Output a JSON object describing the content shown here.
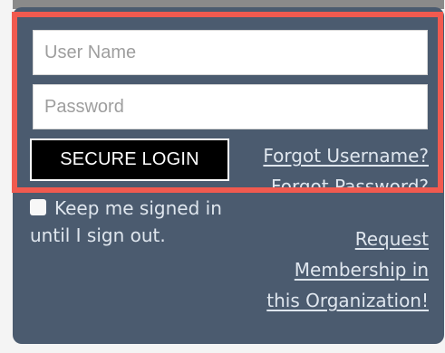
{
  "login": {
    "username_placeholder": "User Name",
    "password_placeholder": "Password",
    "secure_login_label": "SECURE LOGIN",
    "forgot_username_label": "Forgot Username?",
    "forgot_password_label": "Forgot Password?",
    "keep_signed_in_line1": "Keep me signed in",
    "keep_signed_in_line2": "until I sign out.",
    "request_membership_line1": "Request",
    "request_membership_line2": "Membership in",
    "request_membership_line3": "this Organization!"
  },
  "colors": {
    "panel_background": "#4b5b6f",
    "highlight_border": "#f15a4f",
    "button_background": "#000000",
    "link_color": "#dfe6ee"
  },
  "icons": {
    "checkbox": "checkbox-unchecked-icon"
  }
}
